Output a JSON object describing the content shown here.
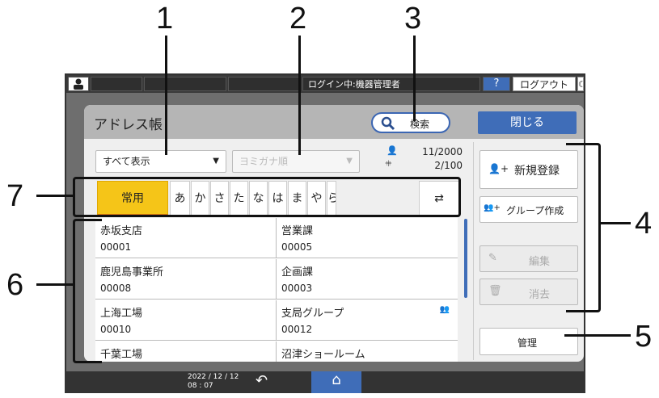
{
  "topbar": {
    "login_status": "ログイン中:機器管理者",
    "help": "?",
    "logout": "ログアウト",
    "user_icon": "user-icon",
    "sleep_icon": "moon-icon"
  },
  "dialog": {
    "title": "アドレス帳",
    "search_label": "検索",
    "close_label": "閉じる"
  },
  "filters": {
    "display": "すべて表示",
    "sort": "ヨミガナ順"
  },
  "counts": {
    "users": "11/2000",
    "groups": "2/100"
  },
  "tabs": [
    "常用",
    "あ",
    "か",
    "さ",
    "た",
    "な",
    "は",
    "ま",
    "や",
    "ら"
  ],
  "active_tab": "常用",
  "entries": [
    {
      "name": "赤坂支店",
      "code": "00001"
    },
    {
      "name": "営業課",
      "code": "00005"
    },
    {
      "name": "鹿児島事業所",
      "code": "00008"
    },
    {
      "name": "企画課",
      "code": "00003"
    },
    {
      "name": "上海工場",
      "code": "00010"
    },
    {
      "name": "支局グループ",
      "code": "00012",
      "group": true
    },
    {
      "name": "千葉工場",
      "code": ""
    },
    {
      "name": "沼津ショールーム",
      "code": ""
    }
  ],
  "buttons": {
    "new": "新規登録",
    "group": "グループ作成",
    "edit": "編集",
    "delete": "消去",
    "manage": "管理"
  },
  "statusbar": {
    "date": "2022 / 12 / 12",
    "time": "08 : 07"
  },
  "callouts": [
    "1",
    "2",
    "3",
    "4",
    "5",
    "6",
    "7"
  ],
  "colors": {
    "accent": "#3f6db8",
    "active_tab": "#f5c518"
  }
}
